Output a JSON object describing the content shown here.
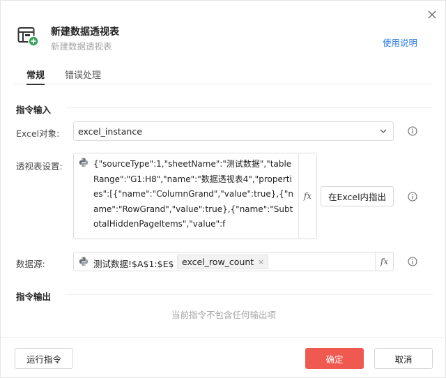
{
  "dialog": {
    "title": "新建数据透视表",
    "subtitle": "新建数据透视表",
    "help_link": "使用说明",
    "icon": "pivot-table-add-icon"
  },
  "tabs": [
    {
      "label": "常规",
      "active": true
    },
    {
      "label": "错误处理",
      "active": false
    }
  ],
  "input_section": {
    "title": "指令输入",
    "excel_object": {
      "label": "Excel对象:",
      "value": "excel_instance"
    },
    "pivot_settings": {
      "label": "透视表设置:",
      "value": "{\"sourceType\":1,\"sheetName\":\"测试数据\",\"tableRange\":\"G1:H8\",\"name\":\"数据透视表4\",\"properties\":[{\"name\":\"ColumnGrand\",\"value\":true},{\"name\":\"RowGrand\",\"value\":true},{\"name\":\"SubtotalHiddenPageItems\",\"value\":f",
      "fx_label": "fx",
      "point_button": "在Excel内指出"
    },
    "data_source": {
      "label": "数据源:",
      "text": "测试数据!$A$1:$E$",
      "chip": "excel_row_count",
      "chip_close": "×",
      "fx_label": "fx"
    }
  },
  "output_section": {
    "title": "指令输出",
    "empty_text": "当前指令不包含任何输出项"
  },
  "footer": {
    "run_button": "运行指令",
    "ok_button": "确定",
    "cancel_button": "取消"
  },
  "colors": {
    "primary": "#f0594f",
    "link": "#2f7de1",
    "icon_green": "#3aa35b"
  }
}
